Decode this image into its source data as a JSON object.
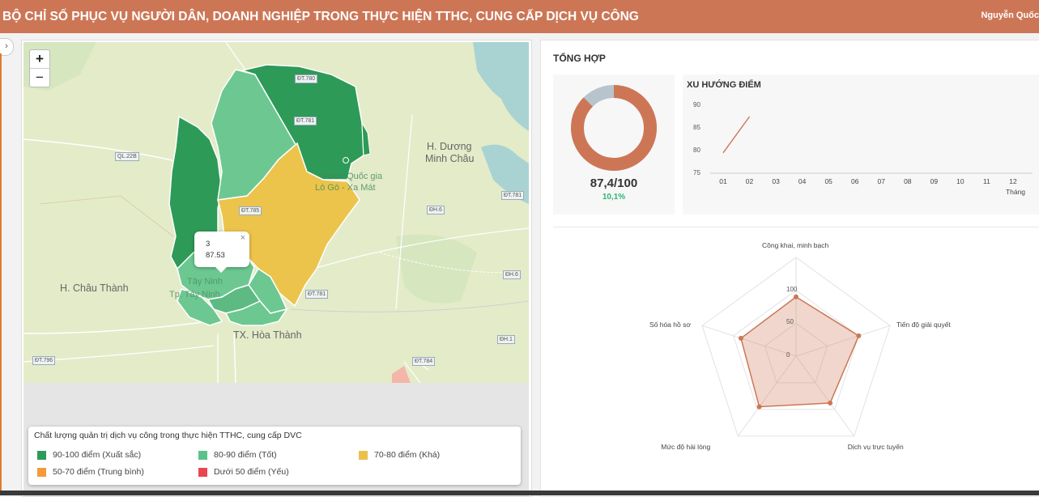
{
  "header": {
    "title": "BỘ CHỈ SỐ PHỤC VỤ NGƯỜI DÂN, DOANH NGHIỆP TRONG THỰC HIỆN TTHC, CUNG CẤP DỊCH VỤ CÔNG",
    "user": "Nguyễn Quốc",
    "bar_color": "#cd7656"
  },
  "sidebar": {
    "toggle_icon": "chevron-right-icon",
    "toggle_glyph": "›"
  },
  "map": {
    "zoom_in": "+",
    "zoom_out": "−",
    "popup": {
      "line1": "3",
      "line2": "87.53",
      "close": "×"
    },
    "place_labels": {
      "duong_minh_chau_1": "H. Dương",
      "duong_minh_chau_2": "Minh Châu",
      "chau_thanh": "H. Châu Thành",
      "hoa_thanh": "TX. Hòa Thành",
      "vuon_1": "Vườn Quốc gia",
      "vuon_2": "Lò Gò - Xa Mát",
      "tay_ninh_1": "Tây Ninh",
      "tay_ninh_2": "Tp. Tây Ninh"
    },
    "roads": {
      "ql22b": "QL.22B",
      "dt781a": "ĐT.781",
      "dt785": "ĐT.785",
      "dt781b": "ĐT.781",
      "dh6a": "ĐH.6",
      "dh6b": "ĐH.6",
      "dt781c": "ĐT.781",
      "dt796": "ĐT.796",
      "dh1": "ĐH.1",
      "dt784": "ĐT.784",
      "dt780": "ĐT.780"
    },
    "legend": {
      "title": "Chất lượng quản trị dịch vụ công trong thực hiện TTHC, cung cấp DVC",
      "items": [
        {
          "label": "90-100 điểm (Xuất sắc)",
          "color": "#2e9a58"
        },
        {
          "label": "80-90 điểm (Tốt)",
          "color": "#5cc287"
        },
        {
          "label": "70-80 điểm (Khá)",
          "color": "#eac14a"
        },
        {
          "label": "50-70 điểm (Trung bình)",
          "color": "#f49a3a"
        },
        {
          "label": "Dưới 50 điểm (Yếu)",
          "color": "#e8474f"
        }
      ]
    }
  },
  "summary": {
    "title": "TỔNG HỢP",
    "score": "87,4/100",
    "change": "10,1%",
    "donut_fraction": 0.874,
    "donut_colors": {
      "fill": "#cd7656",
      "rest": "#b7c4cc"
    }
  },
  "trend": {
    "title": "XU HƯỚNG ĐIỂM",
    "unit_label": "Tháng"
  },
  "chart_data": [
    {
      "type": "line",
      "title": "XU HƯỚNG ĐIỂM",
      "xlabel": "Tháng",
      "ylabel": "",
      "categories": [
        "01",
        "02",
        "03",
        "04",
        "05",
        "06",
        "07",
        "08",
        "09",
        "10",
        "11",
        "12"
      ],
      "series": [
        {
          "values": [
            79.5,
            87.5,
            null,
            null,
            null,
            null,
            null,
            null,
            null,
            null,
            null,
            null
          ],
          "color": "#cd7656"
        }
      ],
      "ylim": [
        75,
        90
      ],
      "yticks": [
        75,
        80,
        85,
        90
      ],
      "grid": false
    },
    {
      "type": "radar",
      "axes": [
        "Công khai, minh bạch",
        "Tiến độ giải quyết",
        "Dịch vụ trực tuyến",
        "Mức độ hài lòng",
        "Số hóa hồ sơ"
      ],
      "values": [
        90,
        100,
        88,
        95,
        88
      ],
      "rticks": [
        0,
        50,
        100
      ],
      "range": [
        0,
        150
      ],
      "color": "#cd7656"
    }
  ]
}
